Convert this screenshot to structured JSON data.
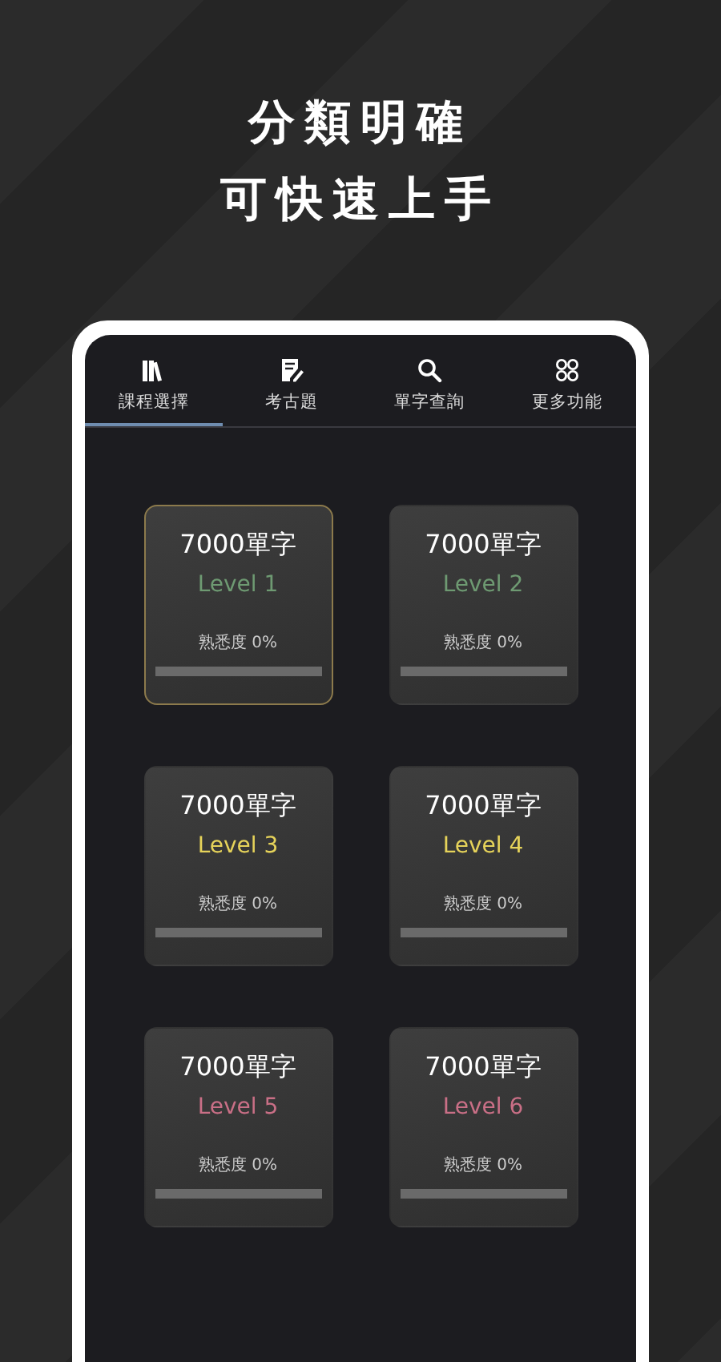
{
  "headline": [
    "分類明確",
    "可快速上手"
  ],
  "tabs": [
    {
      "label": "課程選擇",
      "kind": "books",
      "selected": true
    },
    {
      "label": "考古題",
      "kind": "note",
      "selected": false
    },
    {
      "label": "單字查詢",
      "kind": "search",
      "selected": false
    },
    {
      "label": "更多功能",
      "kind": "grid",
      "selected": false
    }
  ],
  "courses": [
    {
      "title": "7000單字",
      "level_label": "Level 1",
      "color": "#6e9a72",
      "progress_label": "熟悉度 0%",
      "level": 0,
      "selected": true
    },
    {
      "title": "7000單字",
      "level_label": "Level 2",
      "color": "#6e9a72",
      "progress_label": "熟悉度 0%",
      "level": 0,
      "selected": false
    },
    {
      "title": "7000單字",
      "level_label": "Level 3",
      "color": "#e6d35a",
      "progress_label": "熟悉度 0%",
      "level": 0,
      "selected": false
    },
    {
      "title": "7000單字",
      "level_label": "Level 4",
      "color": "#e6d35a",
      "progress_label": "熟悉度 0%",
      "level": 0,
      "selected": false
    },
    {
      "title": "7000單字",
      "level_label": "Level 5",
      "color": "#c96f86",
      "progress_label": "熟悉度 0%",
      "level": 0,
      "selected": false
    },
    {
      "title": "7000單字",
      "level_label": "Level 6",
      "color": "#c96f86",
      "progress_label": "熟悉度 0%",
      "level": 0,
      "selected": false
    }
  ]
}
